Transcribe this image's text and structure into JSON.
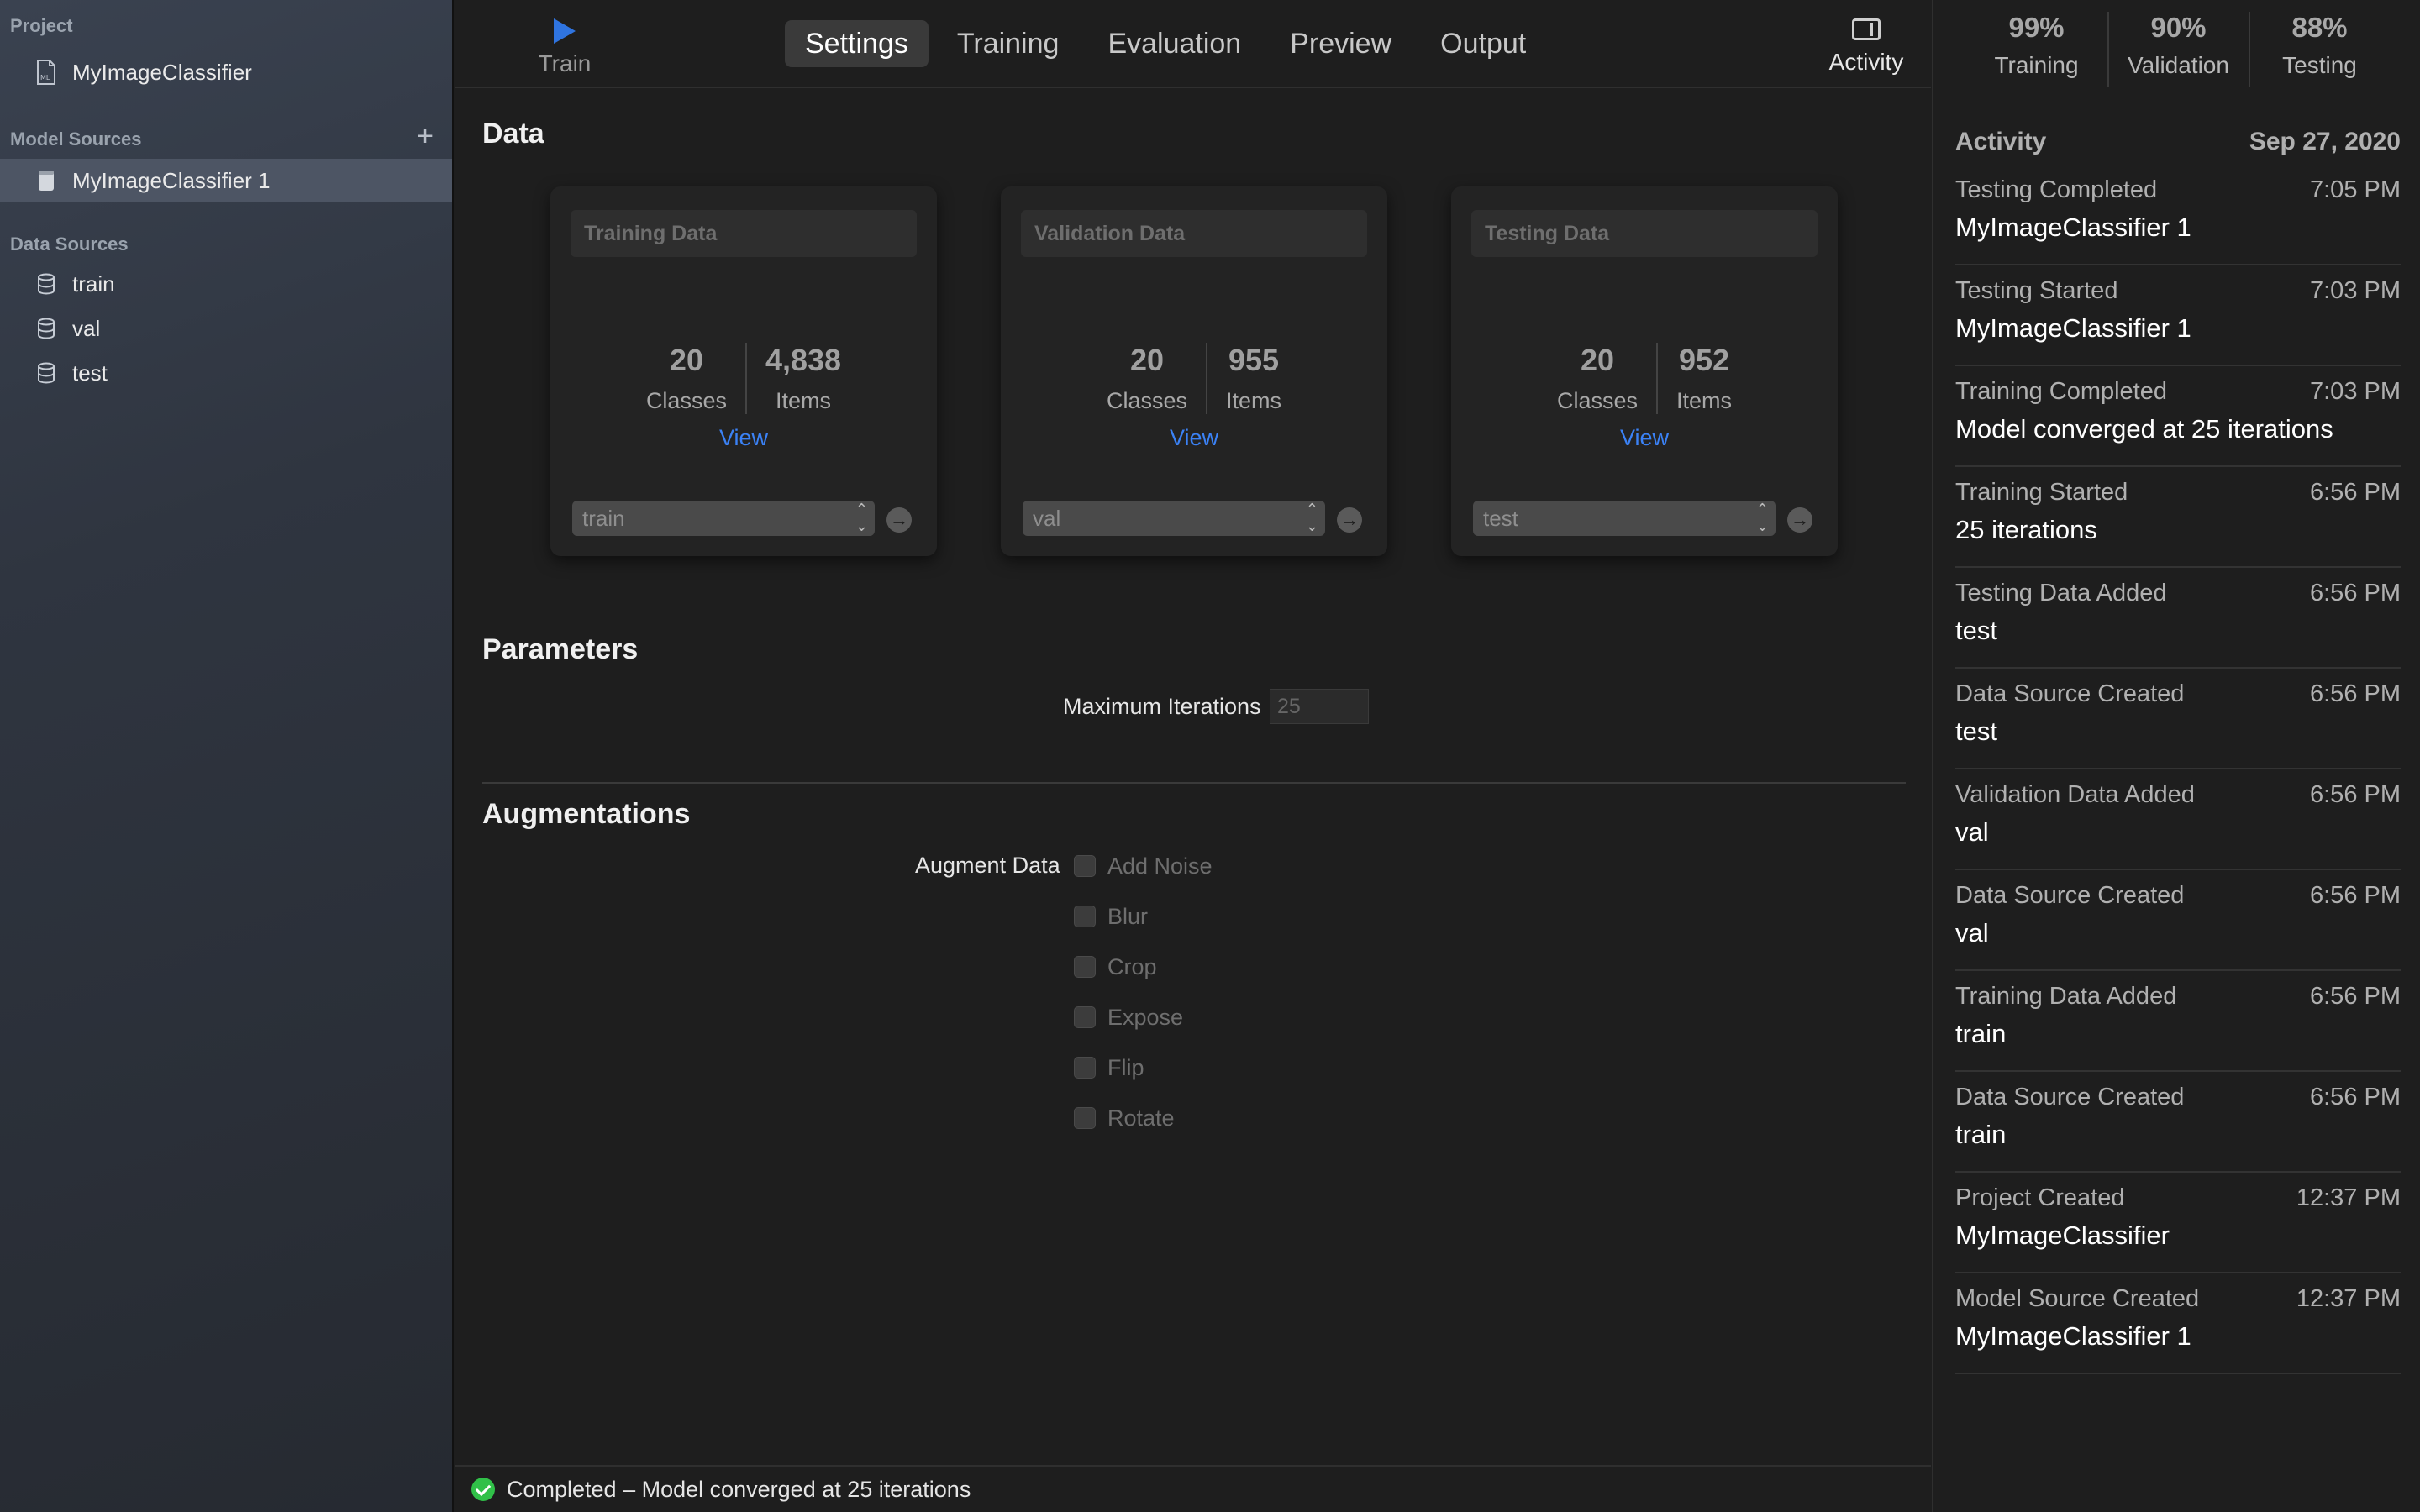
{
  "sidebar": {
    "project_header": "Project",
    "project_name": "MyImageClassifier",
    "model_sources_header": "Model Sources",
    "model_source_item": "MyImageClassifier 1",
    "data_sources_header": "Data Sources",
    "data_sources": [
      "train",
      "val",
      "test"
    ]
  },
  "toolbar": {
    "train_label": "Train",
    "tabs": [
      "Settings",
      "Training",
      "Evaluation",
      "Preview",
      "Output"
    ],
    "active_tab": "Settings",
    "activity_label": "Activity"
  },
  "data_section": {
    "title": "Data",
    "cards": [
      {
        "title": "Training Data",
        "classes": "20",
        "classes_label": "Classes",
        "items": "4,838",
        "items_label": "Items",
        "view": "View",
        "source": "train"
      },
      {
        "title": "Validation Data",
        "classes": "20",
        "classes_label": "Classes",
        "items": "955",
        "items_label": "Items",
        "view": "View",
        "source": "val"
      },
      {
        "title": "Testing Data",
        "classes": "20",
        "classes_label": "Classes",
        "items": "952",
        "items_label": "Items",
        "view": "View",
        "source": "test"
      }
    ]
  },
  "parameters": {
    "title": "Parameters",
    "max_iter_label": "Maximum Iterations",
    "max_iter_value": "25"
  },
  "augmentations": {
    "title": "Augmentations",
    "label": "Augment Data",
    "options": [
      "Add Noise",
      "Blur",
      "Crop",
      "Expose",
      "Flip",
      "Rotate"
    ]
  },
  "status": {
    "message": "Completed – Model converged at 25 iterations",
    "color": "#30c048"
  },
  "metrics": [
    {
      "value": "99%",
      "label": "Training"
    },
    {
      "value": "90%",
      "label": "Validation"
    },
    {
      "value": "88%",
      "label": "Testing"
    }
  ],
  "activity": {
    "header": "Activity",
    "date": "Sep 27, 2020",
    "items": [
      {
        "event": "Testing Completed",
        "time": "7:05 PM",
        "detail": "MyImageClassifier 1"
      },
      {
        "event": "Testing Started",
        "time": "7:03 PM",
        "detail": "MyImageClassifier 1"
      },
      {
        "event": "Training Completed",
        "time": "7:03 PM",
        "detail": "Model converged at 25 iterations"
      },
      {
        "event": "Training Started",
        "time": "6:56 PM",
        "detail": "25 iterations"
      },
      {
        "event": "Testing Data Added",
        "time": "6:56 PM",
        "detail": "test"
      },
      {
        "event": "Data Source Created",
        "time": "6:56 PM",
        "detail": "test"
      },
      {
        "event": "Validation Data Added",
        "time": "6:56 PM",
        "detail": "val"
      },
      {
        "event": "Data Source Created",
        "time": "6:56 PM",
        "detail": "val"
      },
      {
        "event": "Training Data Added",
        "time": "6:56 PM",
        "detail": "train"
      },
      {
        "event": "Data Source Created",
        "time": "6:56 PM",
        "detail": "train"
      },
      {
        "event": "Project Created",
        "time": "12:37 PM",
        "detail": "MyImageClassifier"
      },
      {
        "event": "Model Source Created",
        "time": "12:37 PM",
        "detail": "MyImageClassifier 1"
      }
    ]
  },
  "colors": {
    "accent": "#2f74e0",
    "link": "#3b82f6",
    "sidebar_selected": "#4d5564"
  }
}
